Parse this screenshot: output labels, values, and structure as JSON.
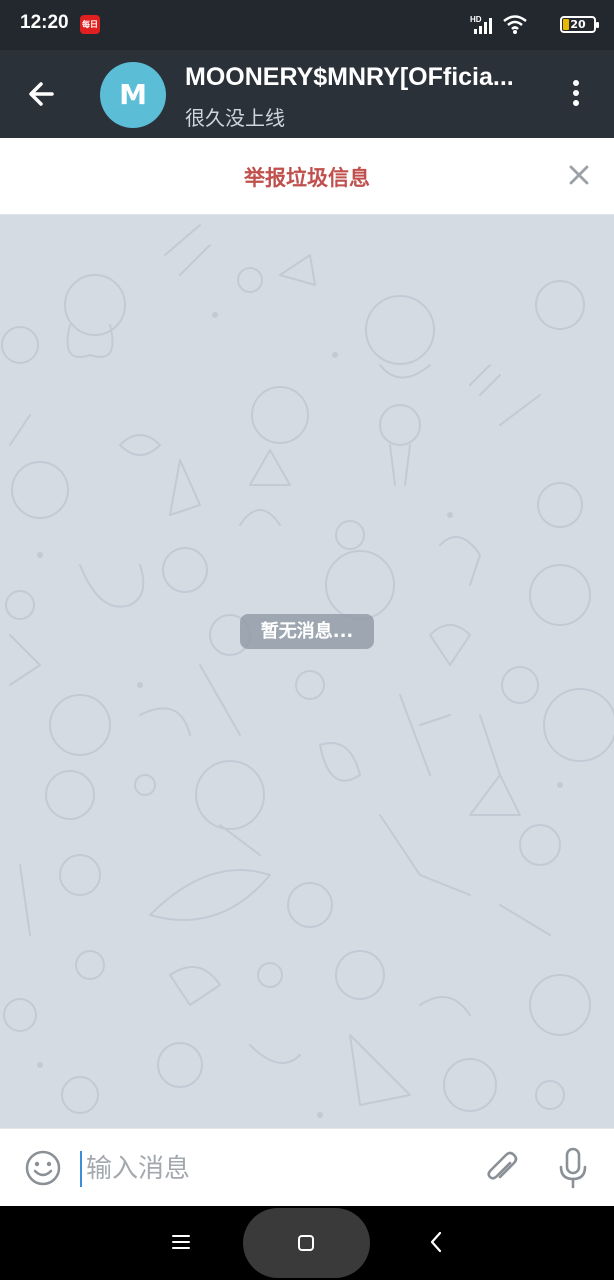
{
  "status_bar": {
    "time": "12:20",
    "notification_badge": "每日",
    "battery_level": "20",
    "icons": [
      "hd-signal-icon",
      "wifi-icon",
      "battery-icon"
    ]
  },
  "header": {
    "avatar_letter": "M",
    "avatar_color": "#5bbdd6",
    "title": "MOONERY$MNRY[OFficia...",
    "status": "很久没上线",
    "icons": [
      "back-arrow-icon",
      "more-vertical-icon"
    ]
  },
  "report_bar": {
    "label": "举报垃圾信息",
    "label_color": "#c0504d",
    "icons": [
      "close-icon"
    ]
  },
  "chat": {
    "empty_message": "暂无消息..."
  },
  "composer": {
    "placeholder": "输入消息",
    "value": "",
    "icons": [
      "emoji-icon",
      "attach-icon",
      "microphone-icon"
    ]
  },
  "nav_bar": {
    "icons": [
      "menu-icon",
      "home-icon",
      "back-icon"
    ]
  }
}
